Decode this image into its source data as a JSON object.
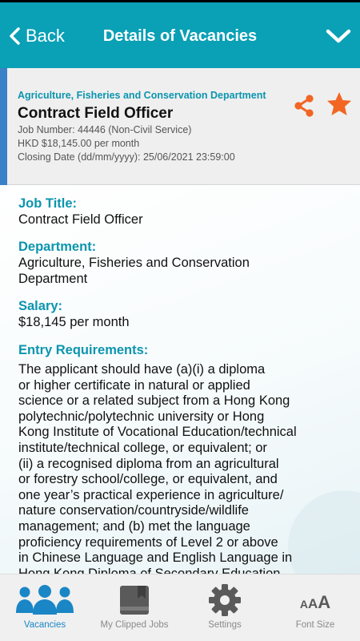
{
  "nav": {
    "back_label": "Back",
    "title": "Details of Vacancies"
  },
  "summary": {
    "department": "Agriculture, Fisheries and Conservation Department",
    "title": "Contract Field Officer",
    "job_number": "Job Number: 44446 (Non-Civil Service)",
    "salary": "HKD $18,145.00 per month",
    "closing_date": "Closing Date (dd/mm/yyyy): 25/06/2021 23:59:00"
  },
  "details": {
    "job_title_label": "Job Title:",
    "job_title": "Contract Field Officer",
    "department_label": "Department:",
    "department_line1": "Agriculture, Fisheries and Conservation",
    "department_line2": "Department",
    "salary_label": "Salary:",
    "salary": "$18,145 per month",
    "entry_label": "Entry Requirements:",
    "entry_lines": [
      "The applicant should have (a)(i) a diploma",
      "or higher certificate in natural or applied",
      "science or a related subject from a Hong Kong",
      "polytechnic/polytechnic university or Hong",
      "Kong Institute of Vocational Education/technical",
      "institute/technical college, or equivalent; or",
      "(ii) a recognised diploma from an agricultural",
      "or forestry school/college, or equivalent, and",
      "one year’s practical experience in agriculture/",
      "nature conservation/countryside/wildlife",
      "management; and (b) met the language",
      "proficiency requirements of Level 2 or above",
      "in Chinese Language and English Language in",
      "Hong Kong Diploma of Secondary Education"
    ]
  },
  "tabs": {
    "vacancies": "Vacancies",
    "clipped": "My Clipped Jobs",
    "settings": "Settings",
    "font_size": "Font Size",
    "font_size_glyph": [
      "A",
      "A",
      "A"
    ]
  },
  "colors": {
    "brand": "#0aa0b6",
    "accent_label": "#0b95ae",
    "share_and_star": "#f26522",
    "active_tab": "#1a86c6"
  },
  "icons": {
    "back": "chevron-left-icon",
    "collapse": "chevron-down-icon",
    "share": "share-icon",
    "favorite": "star-icon",
    "vacancies": "people-icon",
    "clipped": "book-icon",
    "settings": "gear-icon"
  }
}
